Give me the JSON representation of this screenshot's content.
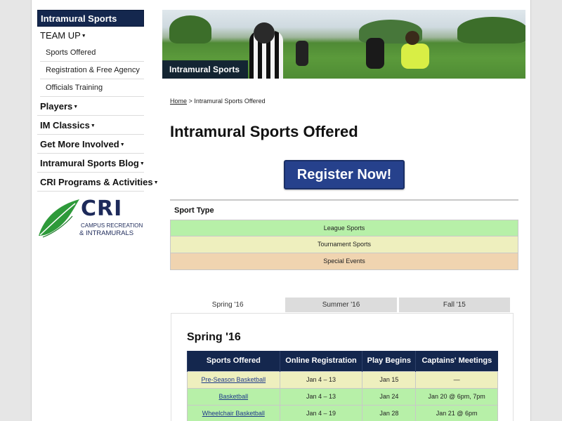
{
  "sidebar": {
    "home_label": "Intramural Sports Home",
    "team_up_label": "TEAM UP",
    "team_up_items": [
      "Sports Offered",
      "Registration & Free Agency",
      "Officials Training"
    ],
    "items": [
      "Players",
      "IM Classics",
      "Get More Involved",
      "Intramural Sports Blog",
      "CRI Programs & Activities"
    ],
    "logo": {
      "acronym": "CRI",
      "line1": "CAMPUS RECREATION",
      "line2": "& INTRAMURALS"
    }
  },
  "banner": {
    "label": "Intramural Sports"
  },
  "breadcrumb": {
    "home": "Home",
    "separator": ">",
    "current": "Intramural Sports Offered"
  },
  "main": {
    "title": "Intramural Sports Offered",
    "register_label": "Register Now!"
  },
  "sport_type": {
    "header": "Sport Type",
    "rows": [
      {
        "label": "League Sports",
        "color": "#b7f0a8"
      },
      {
        "label": "Tournament Sports",
        "color": "#eeefbe"
      },
      {
        "label": "Special Events",
        "color": "#f0d4b0"
      }
    ]
  },
  "tabs": [
    "Spring '16",
    "Summer '16",
    "Fall '15"
  ],
  "active_tab": 0,
  "season": {
    "title": "Spring '16",
    "columns": [
      "Sports Offered",
      "Online Registration",
      "Play Begins",
      "Captains' Meetings"
    ],
    "rows": [
      {
        "sport": "Pre-Season Basketball",
        "registration": "Jan 4 – 13",
        "play_begins": "Jan 15",
        "meetings": "—",
        "color": "#eeefbe"
      },
      {
        "sport": "Basketball",
        "registration": "Jan 4 – 13",
        "play_begins": "Jan 24",
        "meetings": "Jan 20 @ 6pm, 7pm",
        "color": "#b7f0a8"
      },
      {
        "sport": "Wheelchair Basketball",
        "registration": "Jan 4 – 19",
        "play_begins": "Jan 28",
        "meetings": "Jan 21 @ 6pm",
        "color": "#b7f0a8"
      }
    ]
  },
  "colors": {
    "navy": "#14274e",
    "register_blue": "#26418c"
  }
}
